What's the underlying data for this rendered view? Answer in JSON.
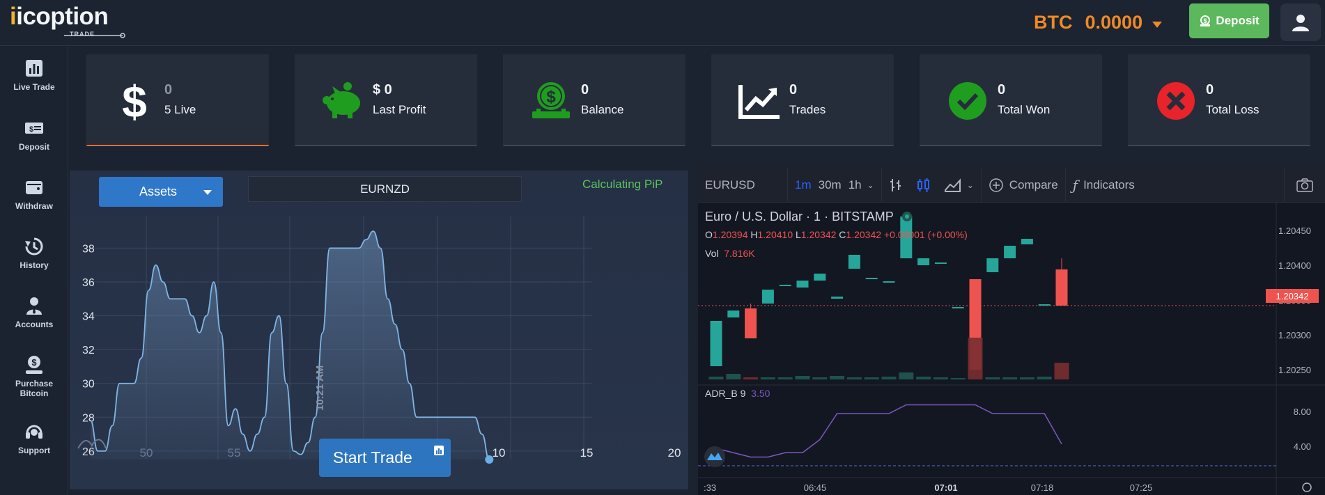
{
  "header": {
    "logo_main": "icoption",
    "logo_sub": "TRADE",
    "wallet_currency": "BTC",
    "wallet_amount": "0.0000",
    "deposit_label": "Deposit"
  },
  "sidebar": {
    "items": [
      {
        "label": "Live Trade",
        "icon": "bar-chart-icon"
      },
      {
        "label": "Deposit",
        "icon": "money-bill-icon"
      },
      {
        "label": "Withdraw",
        "icon": "wallet-icon"
      },
      {
        "label": "History",
        "icon": "history-icon"
      },
      {
        "label": "Accounts",
        "icon": "user-tie-icon"
      },
      {
        "label": "Purchase Bitcoin",
        "icon": "bitcoin-hand-icon"
      },
      {
        "label": "Support",
        "icon": "headset-icon"
      }
    ]
  },
  "stats": [
    {
      "value": "0",
      "label": "5 Live",
      "icon": "dollar-icon"
    },
    {
      "value": "$ 0",
      "label": "Last Profit",
      "icon": "piggy-bank-icon"
    },
    {
      "value": "0",
      "label": "Balance",
      "icon": "money-hand-icon"
    },
    {
      "value": "0",
      "label": "Trades",
      "icon": "line-chart-icon"
    },
    {
      "value": "0",
      "label": "Total Won",
      "icon": "check-circle-icon"
    },
    {
      "value": "0",
      "label": "Total Loss",
      "icon": "x-circle-icon"
    }
  ],
  "trade_panel": {
    "assets_label": "Assets",
    "pair": "EURNZD",
    "status": "Calculating PiP",
    "start_trade_label": "Start Trade",
    "time_label": "10:21 AM"
  },
  "colors": {
    "accent_blue": "#2f77c8",
    "deposit_green": "#5cb85c",
    "bitcoin_orange": "#f08a24",
    "won_green": "#1f9d1f",
    "loss_red": "#e8232a",
    "tv_up": "#26a69a",
    "tv_down": "#ef5350"
  },
  "chart_data": [
    {
      "type": "area",
      "x_ticks": [
        "50",
        "55",
        "10",
        "15",
        "20"
      ],
      "y_ticks": [
        26,
        28,
        30,
        32,
        34,
        36,
        38
      ],
      "ylim": [
        25.5,
        39.5
      ],
      "x": [
        0,
        1,
        2,
        3,
        4,
        5,
        6,
        7,
        8,
        9,
        10,
        11,
        12,
        13,
        14,
        15,
        16,
        17,
        18,
        19,
        20,
        21,
        22,
        23,
        24,
        25,
        26,
        27,
        28,
        29,
        30,
        31,
        32,
        33,
        34,
        35,
        36,
        37,
        38,
        39,
        40,
        41,
        42,
        43,
        44,
        45,
        46,
        47,
        48,
        49,
        50,
        51,
        52,
        53,
        54,
        55,
        56,
        57,
        58,
        59,
        60,
        61,
        62,
        63,
        64,
        65,
        66,
        67,
        68,
        69,
        70,
        71,
        72,
        73,
        74,
        75
      ],
      "values": [
        27.8,
        26.0,
        26.0,
        27.5,
        30.0,
        30.0,
        30.0,
        31.5,
        35.5,
        37.0,
        36.0,
        35.0,
        35.0,
        35.0,
        34.0,
        33.0,
        34.0,
        36.0,
        33.0,
        27.5,
        28.5,
        27.0,
        26.0,
        27.0,
        28.0,
        33.0,
        34.0,
        30.0,
        26.0,
        25.8,
        26.5,
        28.0,
        33.0,
        38.0,
        38.0,
        38.0,
        38.0,
        38.0,
        38.5,
        39.0,
        38.0,
        35.0,
        33.5,
        32.0,
        30.0,
        28.0,
        28.0,
        28.0,
        28.0,
        28.0,
        28.0,
        28.0,
        28.0,
        28.0,
        27.0,
        25.5
      ]
    },
    {
      "type": "candlestick",
      "title": "Euro / U.S. Dollar",
      "interval": "1",
      "exchange": "BITSTAMP",
      "symbol": "EURUSD",
      "ohlc": {
        "O": "1.20394",
        "H": "1.20410",
        "L": "1.20342",
        "C": "1.20342",
        "change": "+0.00001 (+0.00%)"
      },
      "volume": "7.816K",
      "y_ticks": [
        "1.20450",
        "1.20400",
        "1.20350",
        "1.20300",
        "1.20250"
      ],
      "last_price": "1.20342",
      "x_ticks": [
        ":33",
        "06:45",
        "07:01",
        "07:18",
        "07:25"
      ],
      "candles": [
        {
          "o": 1.20255,
          "h": 1.2026,
          "l": 1.20255,
          "c": 1.2032
        },
        {
          "o": 1.20325,
          "h": 1.20325,
          "l": 1.20325,
          "c": 1.20335
        },
        {
          "o": 1.20338,
          "h": 1.20345,
          "l": 1.20295,
          "c": 1.20295
        },
        {
          "o": 1.20345,
          "h": 1.20345,
          "l": 1.20345,
          "c": 1.20365
        },
        {
          "o": 1.2037,
          "h": 1.2037,
          "l": 1.2037,
          "c": 1.20372
        },
        {
          "o": 1.20368,
          "h": 1.20368,
          "l": 1.20368,
          "c": 1.20378
        },
        {
          "o": 1.20378,
          "h": 1.20378,
          "l": 1.20378,
          "c": 1.20388
        },
        {
          "o": 1.20352,
          "h": 1.20352,
          "l": 1.20352,
          "c": 1.20355
        },
        {
          "o": 1.20395,
          "h": 1.20395,
          "l": 1.20395,
          "c": 1.20415
        },
        {
          "o": 1.2038,
          "h": 1.2038,
          "l": 1.2038,
          "c": 1.20382
        },
        {
          "o": 1.20375,
          "h": 1.20375,
          "l": 1.20375,
          "c": 1.20377
        },
        {
          "o": 1.2041,
          "h": 1.2047,
          "l": 1.2041,
          "c": 1.2047
        },
        {
          "o": 1.204,
          "h": 1.204,
          "l": 1.204,
          "c": 1.2041
        },
        {
          "o": 1.20402,
          "h": 1.20402,
          "l": 1.20402,
          "c": 1.20404
        },
        {
          "o": 1.20338,
          "h": 1.20338,
          "l": 1.20338,
          "c": 1.2034
        },
        {
          "o": 1.2038,
          "h": 1.2038,
          "l": 1.2025,
          "c": 1.2025
        },
        {
          "o": 1.2039,
          "h": 1.2039,
          "l": 1.2039,
          "c": 1.2041
        },
        {
          "o": 1.2041,
          "h": 1.2041,
          "l": 1.2041,
          "c": 1.20428
        },
        {
          "o": 1.2043,
          "h": 1.2043,
          "l": 1.2043,
          "c": 1.20438
        },
        {
          "o": 1.20342,
          "h": 1.20342,
          "l": 1.20342,
          "c": 1.20344
        },
        {
          "o": 1.20394,
          "h": 1.2041,
          "l": 1.20342,
          "c": 1.20342
        }
      ],
      "indicator": {
        "name": "ADR_B",
        "period": "9",
        "value": "3.50",
        "y_ticks": [
          "8.00",
          "4.00"
        ]
      }
    }
  ],
  "tv_toolbar": {
    "symbol": "EURUSD",
    "intervals": [
      "1m",
      "30m",
      "1h"
    ],
    "compare_label": "Compare",
    "indicators_label": "Indicators"
  }
}
